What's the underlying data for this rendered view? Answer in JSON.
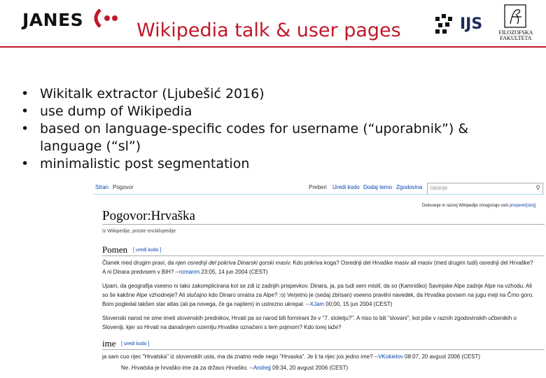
{
  "header": {
    "logo_left": "JANES",
    "title": "Wikipedia talk & user pages",
    "logo_ijs": "IJS",
    "logo_ff_line1": "FILOZOFSKA",
    "logo_ff_line2": "FAKULTETA"
  },
  "bullets": [
    "Wikitalk extractor (Ljubešić 2016)",
    "use dump of Wikipedia",
    "based on language-specific codes for username (“uporabnik”) & language (“sl”)",
    "minimalistic post segmentation"
  ],
  "wiki": {
    "tabs_left": [
      "Stran",
      "Pogovor"
    ],
    "tabs_right": [
      "Preberi",
      "Uredi kodo",
      "Dodaj temo",
      "Zgodovina"
    ],
    "search_placeholder": "Iskanje",
    "notice_text": "Delovanje in razvoj Wikipedije omogočajo vaši",
    "notice_link": "prispevki",
    "notice_hide": "[skrij]",
    "page_title": "Pogovor:Hrvaška",
    "from_line": "Iz Wikipedije, proste enciklopedije",
    "sections": [
      {
        "heading": "Pomen",
        "edit": "[ uredi kodo ]",
        "paras": [
          {
            "pre": "Članek med drugim pravi, da ",
            "em": "njen osrednji del pokriva Dinarski gorski masiv.",
            "mid": " Kdo pokriva koga? Osrednji del Hrvaške masiv all masiv (med drugim tudi) osrednji del Hrvaške? A ni Dinara predvsem v BiH? --",
            "link": "romanm",
            "post": " 23:05, 14 jun 2004 (CEST)"
          },
          {
            "pre": "Upam, da geografija vseeno ni tako zakomplicirana kot se zdi iz zadnjih prispevkov. Dinara, ja, pa tudi sem mislil, da so (Kamniško) Savinjske Alpe zadnje Alpe na vzhodu. Ali so še kakšne Alpe vzhodneje? Ali slučajno kdo Dinaro smatra za Alpe? :o) Verjetno je (sedaj zbrisan) vseeno pravilni navedek, da Hrvaška povsem na jugu meji na Črno goro. Bom pogledal takšen star atlas (ali pa novega, če ga najdem) in ustrezno ukrepal. --",
            "em": "",
            "mid": "",
            "link": "XJam",
            "post": " 00:00, 15 jun 2004 (CEST)"
          },
          {
            "pre": "Slovenski narod ne sme imeti slovenskih prednikov, Hrvati pa so narod bili formirani že v \"7. stoletju?\". A niso to bili \"slovani\", kot piše v raznih zgodovinskih učbenikih o Sloveniji, kjer so Hrvati na današnjem ozemlju Hrvaške označeni s tem pojmom? Kdo torej laže?",
            "em": "",
            "mid": "",
            "link": "",
            "post": ""
          }
        ]
      },
      {
        "heading": "ime",
        "edit": "[ uredi kodo ]",
        "paras": [
          {
            "pre": "ja sam cuo rijec \"Hrvatska\" iz slovenskih usta, ma da znatno rede nego \"Hrvaska\". Je li ta rijec jos jedno ime? --",
            "em": "",
            "mid": "",
            "link": "VKokielov",
            "post": " 08:07, 20 avgust 2006 (CEST)"
          },
          {
            "pre": "Ne. ",
            "em": "Hrvatska",
            "mid": " je hrvaško ime za za državo ",
            "em2": "Hrvaško.",
            "link": "Andrejj",
            "post": " 09:34, 20 avgust 2006 (CEST)"
          }
        ]
      }
    ]
  },
  "colors": {
    "accent": "#c0182a",
    "link": "#0645ad",
    "ijs_blue": "#1b2a5c"
  }
}
